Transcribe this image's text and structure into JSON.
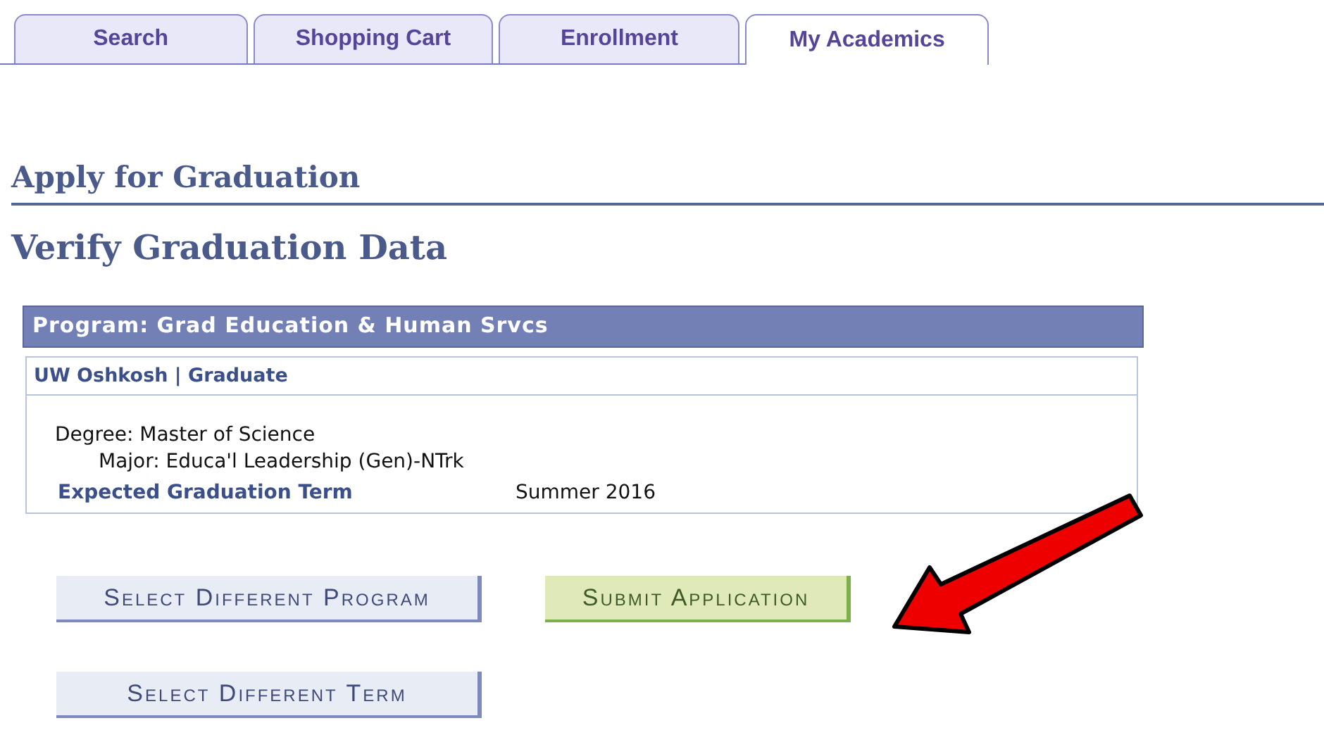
{
  "tabs": [
    {
      "label": "Search",
      "selected": false
    },
    {
      "label": "Shopping Cart",
      "selected": false
    },
    {
      "label": "Enrollment",
      "selected": false
    },
    {
      "label": "My Academics",
      "selected": true
    }
  ],
  "page_title": "Apply for Graduation",
  "section_title": "Verify Graduation Data",
  "program": {
    "header": "Program: Grad Education & Human Srvcs",
    "institution": "UW Oshkosh | Graduate",
    "degree": "Degree: Master of Science",
    "major": "Major: Educa'l Leadership (Gen)-NTrk",
    "term_label": "Expected Graduation Term",
    "term_value": "Summer 2016"
  },
  "buttons": [
    {
      "label": "Select Different Program",
      "kind": "secondary"
    },
    {
      "label": "Submit Application",
      "kind": "primary"
    },
    {
      "label": "Select Different Term",
      "kind": "secondary"
    }
  ]
}
